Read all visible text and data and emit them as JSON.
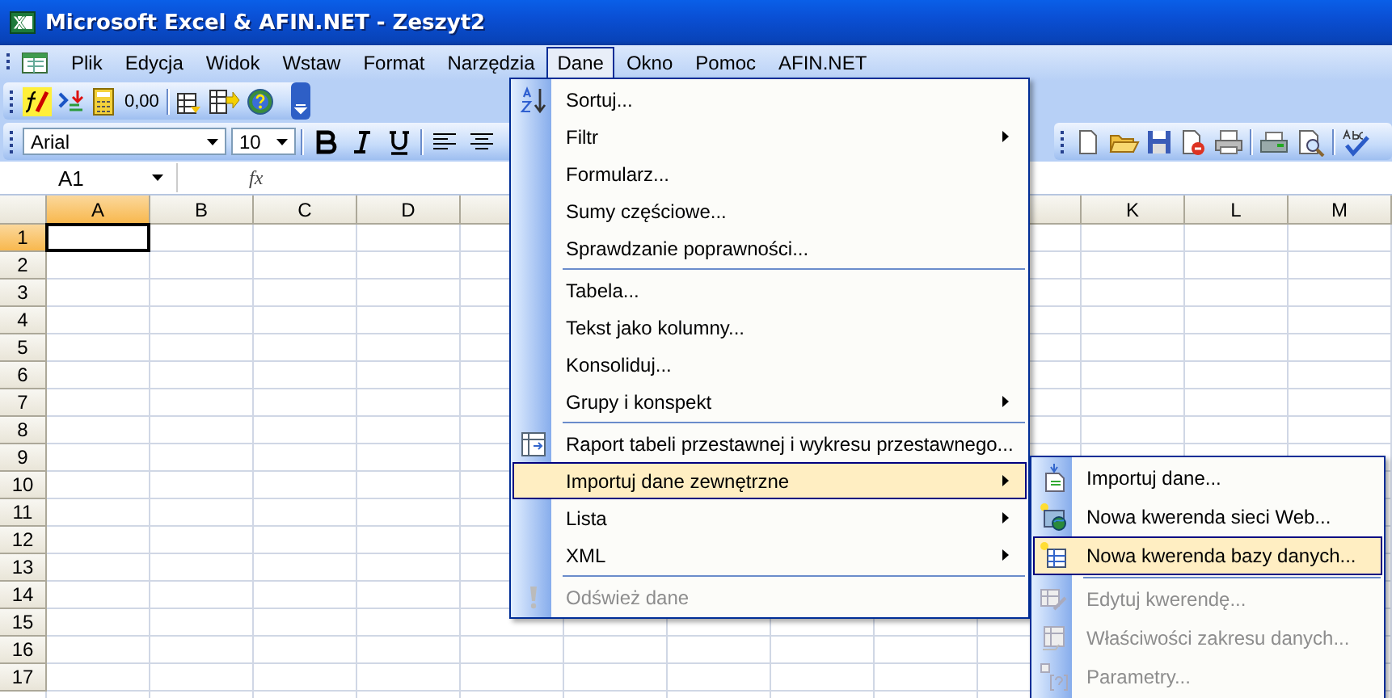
{
  "window": {
    "title": "Microsoft Excel & AFIN.NET - Zeszyt2"
  },
  "menu_bar": [
    {
      "label": "Plik",
      "selected": false
    },
    {
      "label": "Edycja",
      "selected": false
    },
    {
      "label": "Widok",
      "selected": false
    },
    {
      "label": "Wstaw",
      "selected": false
    },
    {
      "label": "Format",
      "selected": false
    },
    {
      "label": "Narzędzia",
      "selected": false
    },
    {
      "label": "Dane",
      "selected": true
    },
    {
      "label": "Okno",
      "selected": false
    },
    {
      "label": "Pomoc",
      "selected": false
    },
    {
      "label": "AFIN.NET",
      "selected": false
    }
  ],
  "toolbar": {
    "number_format": "0,00"
  },
  "formatting": {
    "font": "Arial",
    "size": "10"
  },
  "formula_bar": {
    "name_box": "A1",
    "fx": "fx"
  },
  "columns_left": [
    {
      "label": "A",
      "selected": true
    },
    {
      "label": "B",
      "selected": false
    },
    {
      "label": "C",
      "selected": false
    },
    {
      "label": "D",
      "selected": false
    }
  ],
  "columns_right": [
    {
      "label": "K",
      "selected": false
    },
    {
      "label": "L",
      "selected": false
    },
    {
      "label": "M",
      "selected": false
    }
  ],
  "rows": [
    {
      "label": "1",
      "selected": true
    },
    {
      "label": "2",
      "selected": false
    },
    {
      "label": "3",
      "selected": false
    },
    {
      "label": "4",
      "selected": false
    },
    {
      "label": "5",
      "selected": false
    },
    {
      "label": "6",
      "selected": false
    },
    {
      "label": "7",
      "selected": false
    },
    {
      "label": "8",
      "selected": false
    },
    {
      "label": "9",
      "selected": false
    },
    {
      "label": "10",
      "selected": false
    },
    {
      "label": "11",
      "selected": false
    },
    {
      "label": "12",
      "selected": false
    },
    {
      "label": "13",
      "selected": false
    },
    {
      "label": "14",
      "selected": false
    },
    {
      "label": "15",
      "selected": false
    },
    {
      "label": "16",
      "selected": false
    },
    {
      "label": "17",
      "selected": false
    }
  ],
  "data_menu": [
    {
      "label": "Sortuj...",
      "separator_before": false,
      "submenu": false,
      "disabled": false,
      "selected": false
    },
    {
      "label": "Filtr",
      "separator_before": false,
      "submenu": true,
      "disabled": false,
      "selected": false
    },
    {
      "label": "Formularz...",
      "separator_before": false,
      "submenu": false,
      "disabled": false,
      "selected": false
    },
    {
      "label": "Sumy częściowe...",
      "separator_before": false,
      "submenu": false,
      "disabled": false,
      "selected": false
    },
    {
      "label": "Sprawdzanie poprawności...",
      "separator_before": false,
      "submenu": false,
      "disabled": false,
      "selected": false
    },
    {
      "label": "Tabela...",
      "separator_before": true,
      "submenu": false,
      "disabled": false,
      "selected": false
    },
    {
      "label": "Tekst jako kolumny...",
      "separator_before": false,
      "submenu": false,
      "disabled": false,
      "selected": false
    },
    {
      "label": "Konsoliduj...",
      "separator_before": false,
      "submenu": false,
      "disabled": false,
      "selected": false
    },
    {
      "label": "Grupy i konspekt",
      "separator_before": false,
      "submenu": true,
      "disabled": false,
      "selected": false
    },
    {
      "label": "Raport tabeli przestawnej i wykresu przestawnego...",
      "separator_before": true,
      "submenu": false,
      "disabled": false,
      "selected": false
    },
    {
      "label": "Importuj dane zewnętrzne",
      "separator_before": false,
      "submenu": true,
      "disabled": false,
      "selected": true
    },
    {
      "label": "Lista",
      "separator_before": false,
      "submenu": true,
      "disabled": false,
      "selected": false
    },
    {
      "label": "XML",
      "separator_before": false,
      "submenu": true,
      "disabled": false,
      "selected": false
    },
    {
      "label": "Odśwież dane",
      "separator_before": true,
      "submenu": false,
      "disabled": true,
      "selected": false
    }
  ],
  "import_submenu": [
    {
      "label": "Importuj dane...",
      "separator_before": false,
      "disabled": false,
      "selected": false
    },
    {
      "label": "Nowa kwerenda sieci Web...",
      "separator_before": false,
      "disabled": false,
      "selected": false
    },
    {
      "label": "Nowa kwerenda bazy danych...",
      "separator_before": false,
      "disabled": false,
      "selected": true
    },
    {
      "label": "Edytuj kwerendę...",
      "separator_before": true,
      "disabled": true,
      "selected": false
    },
    {
      "label": "Właściwości zakresu danych...",
      "separator_before": false,
      "disabled": true,
      "selected": false
    },
    {
      "label": "Parametry...",
      "separator_before": false,
      "disabled": true,
      "selected": false
    }
  ]
}
